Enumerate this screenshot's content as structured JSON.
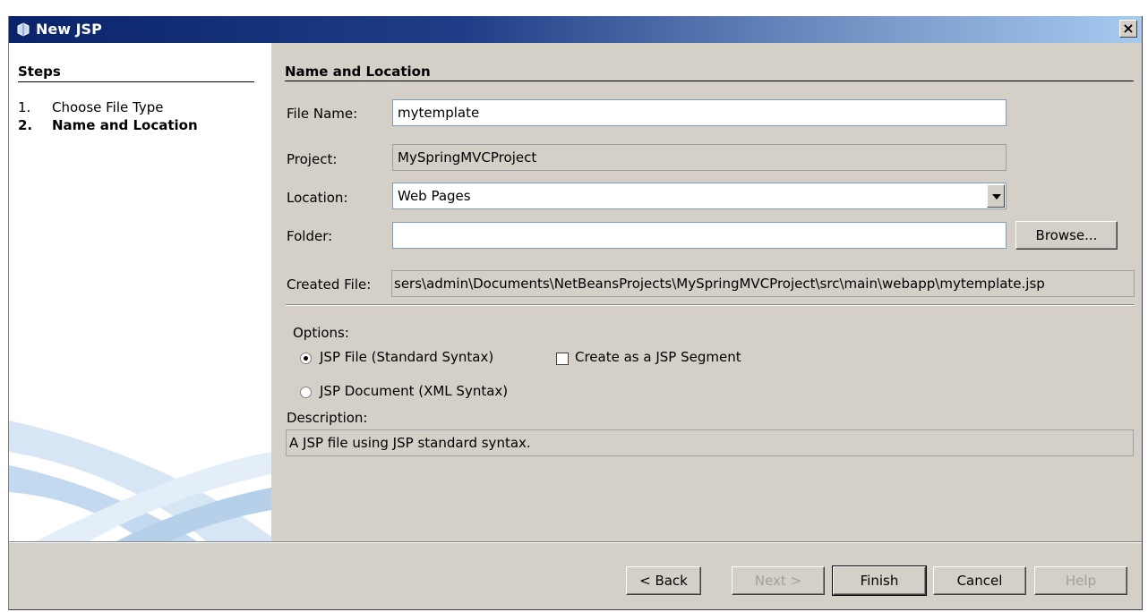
{
  "window": {
    "title": "New JSP",
    "close_symbol": "×",
    "icon": "jsp-file-icon"
  },
  "steps": {
    "heading": "Steps",
    "items": [
      {
        "num": "1.",
        "label": "Choose File Type",
        "current": false
      },
      {
        "num": "2.",
        "label": "Name and Location",
        "current": true
      }
    ]
  },
  "main": {
    "heading": "Name and Location",
    "file_name": {
      "label": "File Name:",
      "value": "mytemplate"
    },
    "project": {
      "label": "Project:",
      "value": "MySpringMVCProject"
    },
    "location": {
      "label": "Location:",
      "value": "Web Pages"
    },
    "folder": {
      "label": "Folder:",
      "value": "",
      "browse_label": "Browse..."
    },
    "created_file": {
      "label": "Created File:",
      "value": "sers\\admin\\Documents\\NetBeansProjects\\MySpringMVCProject\\src\\main\\webapp\\mytemplate.jsp"
    },
    "options": {
      "label": "Options:",
      "radio_standard": {
        "label": "JSP File (Standard Syntax)",
        "checked": true
      },
      "checkbox_segment": {
        "label": "Create as a JSP Segment",
        "checked": false
      },
      "radio_document": {
        "label": "JSP Document (XML Syntax)",
        "checked": false
      }
    },
    "description": {
      "label": "Description:",
      "text": "A JSP file using JSP standard syntax."
    }
  },
  "footer": {
    "back_label": "< Back",
    "next_label": "Next >",
    "finish_label": "Finish",
    "cancel_label": "Cancel",
    "help_label": "Help"
  },
  "colors": {
    "titlebar_start": "#0a246a",
    "titlebar_end": "#a6caf0",
    "dialog_bg": "#d4d0c8"
  }
}
